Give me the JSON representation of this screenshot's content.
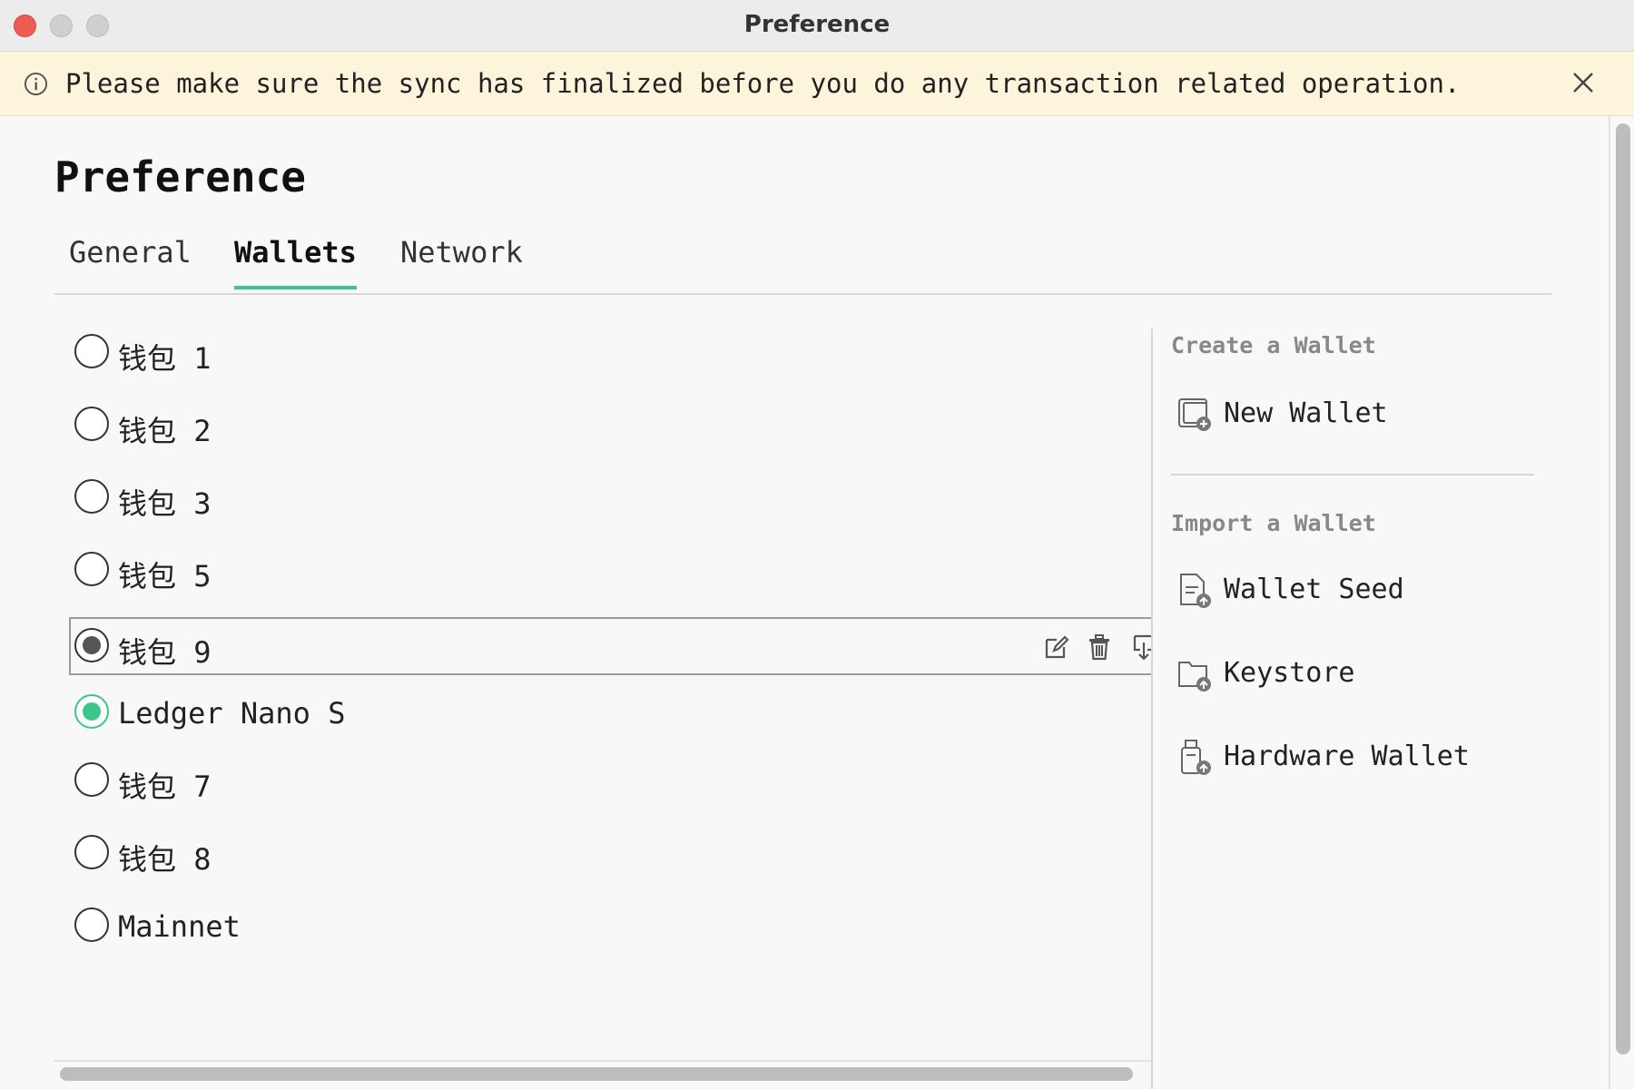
{
  "window": {
    "title": "Preference"
  },
  "banner": {
    "message": "Please make sure the sync has finalized before you do any transaction related operation."
  },
  "page": {
    "title": "Preference"
  },
  "tabs": [
    {
      "label": "General",
      "active": false
    },
    {
      "label": "Wallets",
      "active": true
    },
    {
      "label": "Network",
      "active": false
    }
  ],
  "wallets": [
    {
      "name": "钱包 1",
      "selected": false
    },
    {
      "name": "钱包 2",
      "selected": false
    },
    {
      "name": "钱包 3",
      "selected": false
    },
    {
      "name": "钱包 5",
      "selected": false
    },
    {
      "name": "钱包 9",
      "selected": false,
      "highlighted": true
    },
    {
      "name": "Ledger Nano S",
      "selected": true
    },
    {
      "name": "钱包 7",
      "selected": false
    },
    {
      "name": "钱包 8",
      "selected": false
    },
    {
      "name": "Mainnet",
      "selected": false
    }
  ],
  "side": {
    "create_heading": "Create a Wallet",
    "new_wallet": "New Wallet",
    "import_heading": "Import a Wallet",
    "wallet_seed": "Wallet Seed",
    "keystore": "Keystore",
    "hardware_wallet": "Hardware Wallet"
  },
  "icons": {
    "row_actions": [
      "edit-icon",
      "trash-icon",
      "export-icon"
    ],
    "side": [
      "new-wallet-icon",
      "wallet-seed-icon",
      "keystore-icon",
      "hardware-wallet-icon"
    ]
  },
  "colors": {
    "accent": "#3cc68a",
    "banner_bg": "#fdf4dc",
    "close": "#ee5c55"
  }
}
